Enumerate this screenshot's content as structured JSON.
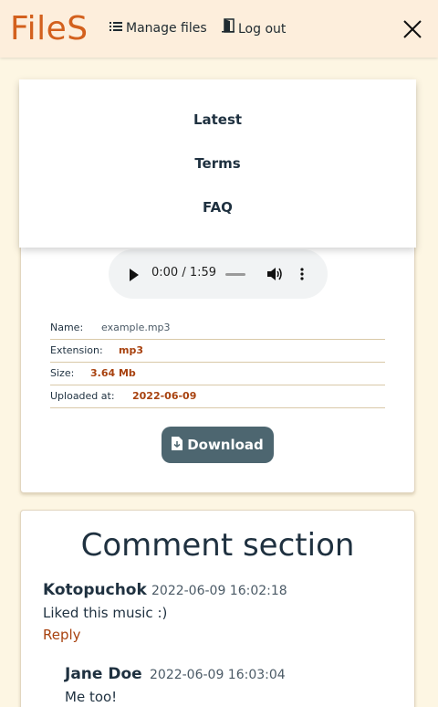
{
  "header": {
    "logo": "FileS",
    "manage_files": "Manage files",
    "log_out": "Log out"
  },
  "menu": {
    "items": [
      "Latest",
      "Terms",
      "FAQ"
    ]
  },
  "player": {
    "time": "0:00 / 1:59"
  },
  "file": {
    "rows": [
      {
        "label": "Name:",
        "value": "example.mp3"
      },
      {
        "label": "Extension:",
        "value": "mp3"
      },
      {
        "label": "Size:",
        "value": "3.64 Mb"
      },
      {
        "label": "Uploaded at:",
        "value": "2022-06-09"
      }
    ],
    "download_label": "Download"
  },
  "comments": {
    "title": "Comment section",
    "items": [
      {
        "author": "Kotopuchok",
        "date": "2022-06-09 16:02:18",
        "text": "Liked this music :)",
        "reply": "Reply"
      },
      {
        "author": "Jane Doe",
        "date": "2022-06-09 16:03:04",
        "text": "Me too!"
      }
    ]
  },
  "colors": {
    "accent": "#d3601d",
    "header_bg": "#fdeedc",
    "page_bg": "#fdf6e3",
    "button_bg": "#4d6670"
  }
}
